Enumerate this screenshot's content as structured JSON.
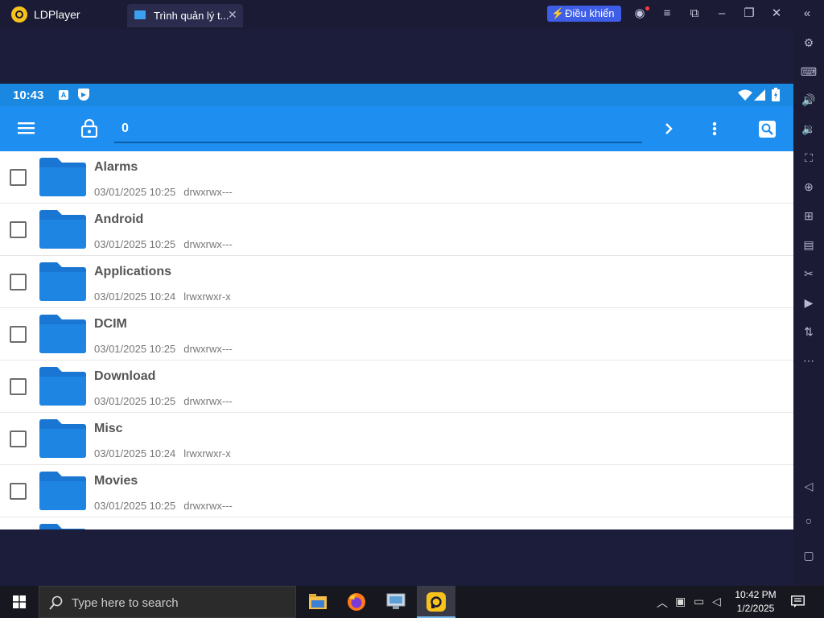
{
  "titlebar": {
    "app_name": "LDPlayer",
    "tab_label": "Trình quản lý t...",
    "control_button": "Điều khiển"
  },
  "android": {
    "status": {
      "time": "10:43"
    },
    "toolbar": {
      "path": "0"
    },
    "files": [
      {
        "name": "Alarms",
        "date": "03/01/2025 10:25",
        "perm": "drwxrwx---"
      },
      {
        "name": "Android",
        "date": "03/01/2025 10:25",
        "perm": "drwxrwx---"
      },
      {
        "name": "Applications",
        "date": "03/01/2025 10:24",
        "perm": "lrwxrwxr-x"
      },
      {
        "name": "DCIM",
        "date": "03/01/2025 10:25",
        "perm": "drwxrwx---"
      },
      {
        "name": "Download",
        "date": "03/01/2025 10:25",
        "perm": "drwxrwx---"
      },
      {
        "name": "Misc",
        "date": "03/01/2025 10:24",
        "perm": "lrwxrwxr-x"
      },
      {
        "name": "Movies",
        "date": "03/01/2025 10:25",
        "perm": "drwxrwx---"
      }
    ]
  },
  "taskbar": {
    "search_placeholder": "Type here to search",
    "clock_time": "10:42 PM",
    "clock_date": "1/2/2025"
  },
  "colors": {
    "status_bar": "#1a87e0",
    "toolbar": "#1e8ef0",
    "folder": "#1976d2",
    "accent_button": "#3f5ee8"
  }
}
